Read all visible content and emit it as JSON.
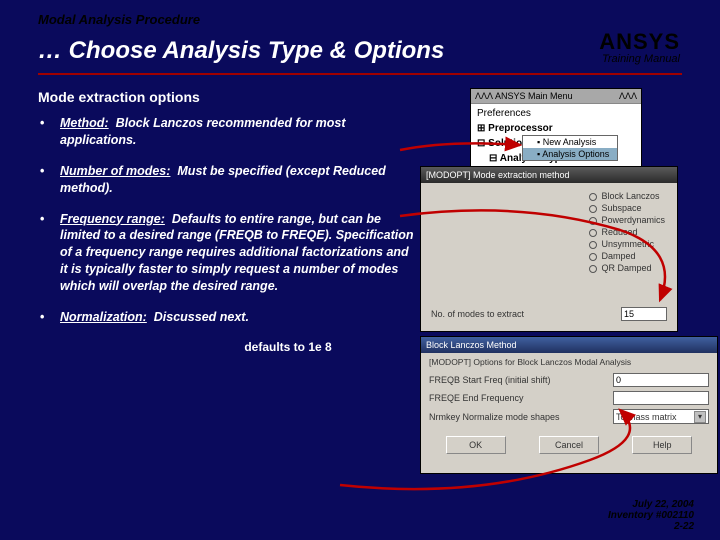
{
  "header": {
    "kicker": "Modal Analysis Procedure",
    "title": "… Choose Analysis Type & Options",
    "brand": "ANSYS",
    "brand_sub": "Training Manual"
  },
  "section_heading": "Mode extraction options",
  "bullets": [
    {
      "label": "Method:",
      "text": "Block Lanczos recommended for most applications."
    },
    {
      "label": "Number of modes:",
      "text": "Must be specified (except Reduced method)."
    },
    {
      "label": "Frequency range:",
      "text": "Defaults to entire range, but can be limited to a desired range (FREQB to FREQE). Specification of a frequency range requires additional factorizations and it is typically faster to simply request a number of modes which will overlap the desired range."
    },
    {
      "label": "Normalization:",
      "text": "Discussed next."
    }
  ],
  "defaults_note": "defaults to 1e 8",
  "win1": {
    "title_left": "ΛΛΛ ANSYS Main Menu",
    "title_right": "ΛΛΛ",
    "items": [
      "Preferences",
      "Preprocessor",
      "Solution",
      "Analysis Type"
    ],
    "tree": [
      "New Analysis",
      "Analysis Options"
    ]
  },
  "win2": {
    "title": "[MODOPT] Mode extraction method",
    "options": [
      "Block Lanczos",
      "Subspace",
      "Powerdynamics",
      "Reduced",
      "Unsymmetric",
      "Damped",
      "QR Damped"
    ],
    "nmodes_label": "No. of modes to extract",
    "nmodes_value": "15"
  },
  "win3": {
    "title": "Block Lanczos Method",
    "subtitle": "[MODOPT] Options for Block Lanczos Modal Analysis",
    "rows": [
      {
        "label": "FREQB  Start Freq (initial shift)",
        "value": "0"
      },
      {
        "label": "FREQE  End Frequency",
        "value": ""
      },
      {
        "label": "Nrmkey  Normalize mode shapes",
        "value": "To mass matrix"
      }
    ],
    "buttons": [
      "OK",
      "Cancel",
      "Help"
    ]
  },
  "footer": {
    "line1": "July 22, 2004",
    "line2": "Inventory #002110",
    "line3": "2-22"
  }
}
